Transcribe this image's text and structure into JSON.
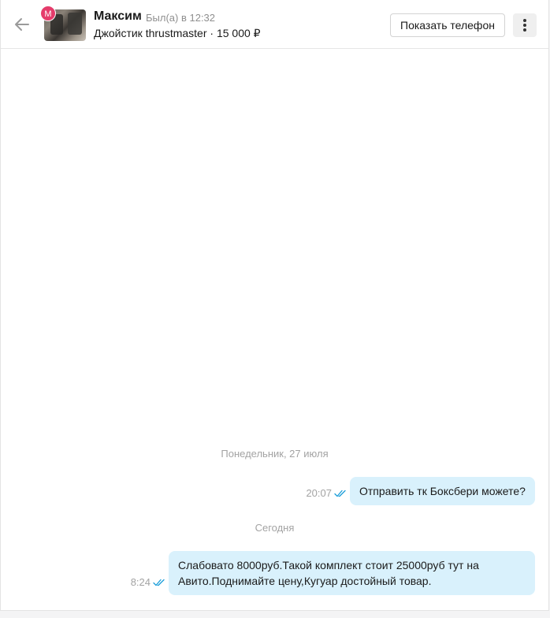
{
  "header": {
    "avatar_letter": "М",
    "name": "Максим",
    "status": "Был(а) в 12:32",
    "item": "Джойстик thrustmaster · 15 000 ₽",
    "phone_button": "Показать телефон"
  },
  "messages": {
    "date1": "Понедельник, 27 июля",
    "msg1": {
      "time": "20:07",
      "text": "Отправить тк Боксбери можете?"
    },
    "date2": "Сегодня",
    "msg2": {
      "time": "8:24",
      "line1": "Слабовато 8000руб.Такой комплект стоит 25000руб тут на",
      "line2": "Авито.Поднимайте цену,Кугуар достойный товар."
    }
  },
  "colors": {
    "accent_avatar": "#e53c6b",
    "bubble": "#d9f1fc",
    "check": "#1a9dd9"
  }
}
